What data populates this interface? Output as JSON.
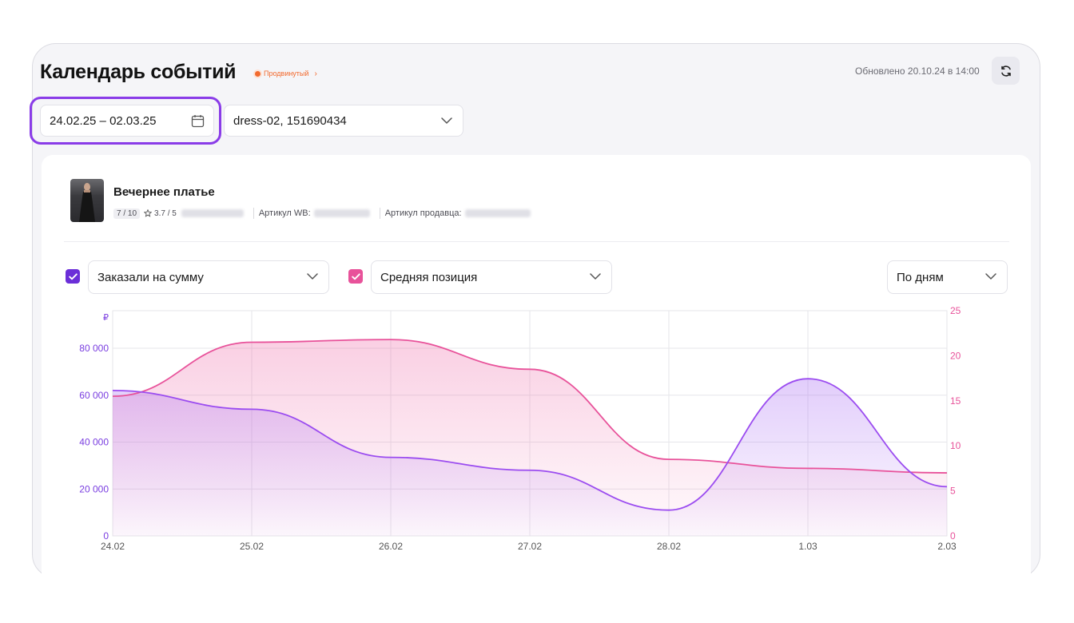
{
  "header": {
    "title": "Календарь событий",
    "plan_badge": "Продвинутый",
    "updated": "Обновлено 20.10.24 в 14:00"
  },
  "filters": {
    "date_range": "24.02.25 – 02.03.25",
    "product": "dress-02, 151690434"
  },
  "product": {
    "name": "Вечернее платье",
    "score": "7 / 10",
    "rating": "3.7 / 5",
    "article_wb_label": "Артикул WB:",
    "article_seller_label": "Артикул продавца:"
  },
  "controls": {
    "metric1": "Заказали на сумму",
    "metric2": "Средняя позиция",
    "period": "По дням"
  },
  "colors": {
    "accent": "#8a3ce8",
    "metric1": "#9b4cf0",
    "metric2": "#e8529a",
    "badge": "#f26a2e"
  },
  "icons": [
    "calendar-icon",
    "refresh-icon",
    "chevron-down-icon",
    "check-icon",
    "star-icon"
  ],
  "chart_data": {
    "type": "area",
    "categories": [
      "24.02",
      "25.02",
      "26.02",
      "27.02",
      "28.02",
      "1.03",
      "2.03"
    ],
    "y_left": {
      "unit": "₽",
      "ticks": [
        "0",
        "20 000",
        "40 000",
        "60 000",
        "80 000"
      ],
      "range": [
        0,
        96000
      ]
    },
    "y_right": {
      "ticks": [
        "0",
        "5",
        "10",
        "15",
        "20",
        "25"
      ],
      "range": [
        0,
        25
      ]
    },
    "series": [
      {
        "name": "Заказали на сумму",
        "axis": "left",
        "color": "#9b4cf0",
        "values": [
          62000,
          54000,
          33500,
          28000,
          11000,
          67000,
          21000
        ]
      },
      {
        "name": "Средняя позиция",
        "axis": "right",
        "color": "#e8529a",
        "values": [
          15.5,
          21.5,
          21.8,
          18.5,
          8.5,
          7.5,
          7.0
        ]
      }
    ],
    "grid": true,
    "legend": "none"
  }
}
